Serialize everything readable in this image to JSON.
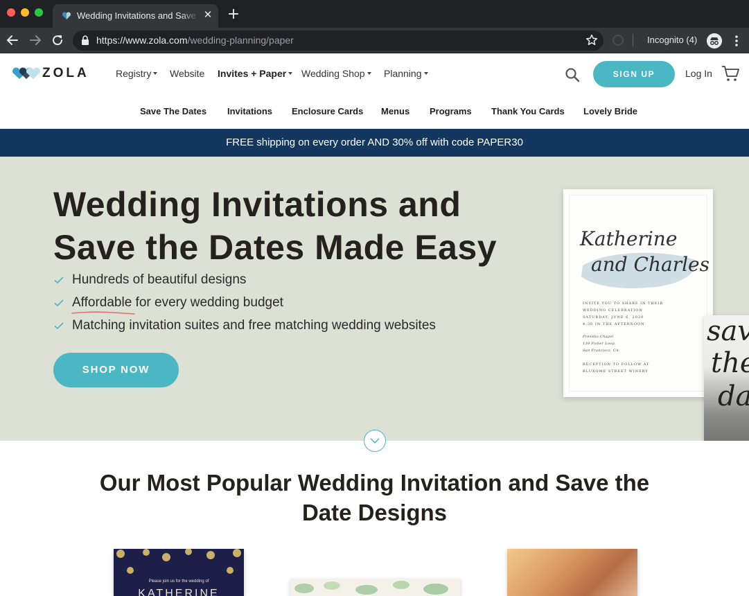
{
  "browser": {
    "tab_title": "Wedding Invitations and Save the Dates Made Easy",
    "url_domain": "https://www.zola.com",
    "url_path": "/wedding-planning/paper",
    "incognito_label": "Incognito (4)"
  },
  "header": {
    "logo_text": "ZOLA",
    "nav": [
      {
        "label": "Registry"
      },
      {
        "label": "Website"
      },
      {
        "label": "Invites + Paper"
      },
      {
        "label": "Wedding Shop"
      },
      {
        "label": "Planning"
      }
    ],
    "signup_label": "SIGN UP",
    "login_label": "Log In",
    "sub_nav": [
      {
        "label": "Save The Dates"
      },
      {
        "label": "Invitations"
      },
      {
        "label": "Enclosure Cards"
      },
      {
        "label": "Menus"
      },
      {
        "label": "Programs"
      },
      {
        "label": "Thank You Cards"
      },
      {
        "label": "Lovely Bride"
      }
    ]
  },
  "promo": {
    "text": "FREE shipping on every order AND 30% off with code PAPER30"
  },
  "hero": {
    "title_line1": "Wedding Invitations and",
    "title_line2": "Save the Dates Made Easy",
    "bullets": [
      {
        "text": "Hundreds of beautiful designs"
      },
      {
        "highlight": "Affordable",
        "text": " for every wedding budget"
      },
      {
        "text": "Matching invitation suites and free matching wedding websites"
      }
    ],
    "cta_label": "SHOP NOW",
    "invitation": {
      "name1": "Katherine",
      "name2": "and Charles",
      "lines": [
        "INVITE YOU TO SHARE IN THEIR",
        "WEDDING CELEBRATION",
        "SATURDAY, JUNE 6, 2020",
        "4:30 IN THE AFTERNOON",
        "Presidio Chapel",
        "130 Fisher Loop,",
        "San Francisco, CA",
        "RECEPTION TO FOLLOW AT",
        "BLUXOME STREET WINERY"
      ]
    },
    "photo_card_text": [
      "sav",
      "the",
      "da"
    ]
  },
  "section": {
    "title_line1": "Our Most Popular Wedding Invitation and Save the",
    "title_line2": "Date Designs",
    "thumb_navy_small": "Please join us for the wedding of",
    "thumb_navy_name": "KATHERINE"
  },
  "colors": {
    "teal": "#4ab7c3",
    "navy": "#13375e",
    "hero_bg": "#dde0d4"
  }
}
